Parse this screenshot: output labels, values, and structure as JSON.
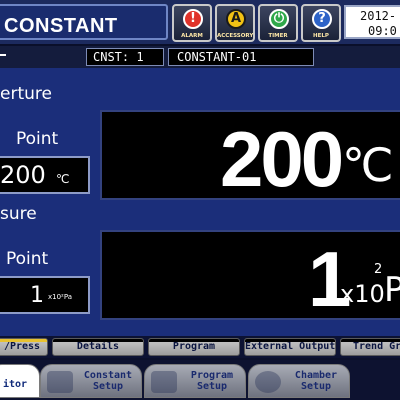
{
  "header": {
    "title": "CONSTANT",
    "buttons": [
      {
        "label": "ALARM",
        "glyph": "!",
        "color": "#e0342b",
        "icon": "alarm-icon"
      },
      {
        "label": "ACCESSORY",
        "glyph": "A",
        "color": "#f2c214",
        "icon": "accessory-icon"
      },
      {
        "label": "TIMER",
        "glyph": "⏻",
        "color": "#2fa84a",
        "icon": "timer-icon"
      },
      {
        "label": "HELP",
        "glyph": "?",
        "color": "#2d63c8",
        "icon": "help-icon"
      }
    ],
    "date": "2012-",
    "time": "09:0"
  },
  "subheader": {
    "cnst": "CNST:  1",
    "name": "CONSTANT-01"
  },
  "temperature": {
    "label": "erture",
    "setpoint_label": "Point",
    "setpoint_value": "200",
    "setpoint_unit": "℃",
    "current_value": "200",
    "current_unit": "℃"
  },
  "pressure": {
    "label": "sure",
    "setpoint_label": "Point",
    "setpoint_value": "1",
    "setpoint_unit": "x10²Pa",
    "current_value": "1",
    "current_unit_base": "x10",
    "current_unit_exp": "2",
    "current_unit_tail": "P"
  },
  "tabs_top": [
    {
      "label": "/Press",
      "accent": "yellow"
    },
    {
      "label": "Details",
      "accent": "dark"
    },
    {
      "label": "Program",
      "accent": "dark"
    },
    {
      "label": "External Output",
      "accent": "dark"
    },
    {
      "label": "Trend Gra",
      "accent": "dark"
    }
  ],
  "tabs_bottom": [
    {
      "label": "itor",
      "state": "active"
    },
    {
      "label": "Constant\nSetup",
      "state": "inactive"
    },
    {
      "label": "Program\nSetup",
      "state": "inactive"
    },
    {
      "label": "Chamber\nSetup",
      "state": "inactive"
    }
  ],
  "colors": {
    "panel": "#1b2e7a",
    "display_bg": "#000000",
    "alarm": "#e0342b",
    "accessory": "#f2c214",
    "timer": "#2fa84a",
    "help": "#2d63c8"
  }
}
